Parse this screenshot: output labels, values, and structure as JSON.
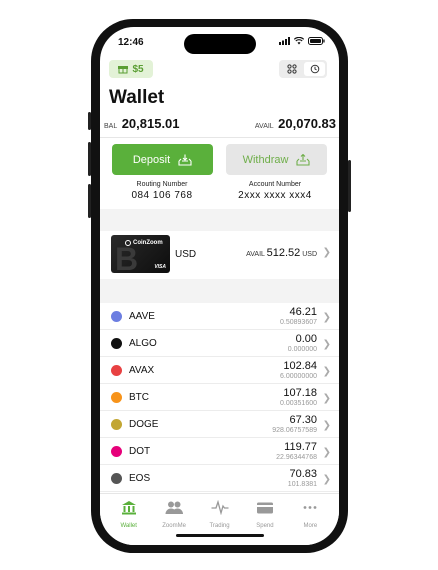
{
  "status": {
    "time": "12:46"
  },
  "gift": {
    "label": "$5"
  },
  "page": {
    "title": "Wallet"
  },
  "balance": {
    "bal_label": "BAL",
    "bal_value": "20,815.01",
    "avail_label": "AVAIL",
    "avail_value": "20,070.83"
  },
  "actions": {
    "deposit_label": "Deposit",
    "withdraw_label": "Withdraw"
  },
  "account": {
    "routing_label": "Routing Number",
    "routing_value": "084 106 768",
    "account_label": "Account Number",
    "account_value": "2xxx xxxx xxx4"
  },
  "card": {
    "brand": "CoinZoom",
    "network": "VISA",
    "currency": "USD",
    "avail_label": "AVAIL",
    "avail_value": "512.52",
    "avail_unit": "USD"
  },
  "coins": [
    {
      "symbol": "AAVE",
      "value": "46.21",
      "sub": "0.50893607",
      "icon": "aave-icon",
      "color": "#6c7ee1"
    },
    {
      "symbol": "ALGO",
      "value": "0.00",
      "sub": "0.000000",
      "icon": "algo-icon",
      "color": "#111111"
    },
    {
      "symbol": "AVAX",
      "value": "102.84",
      "sub": "6.00000000",
      "icon": "avax-icon",
      "color": "#e84142"
    },
    {
      "symbol": "BTC",
      "value": "107.18",
      "sub": "0.00351600",
      "icon": "btc-icon",
      "color": "#f7931a"
    },
    {
      "symbol": "DOGE",
      "value": "67.30",
      "sub": "928.06757589",
      "icon": "doge-icon",
      "color": "#c2a633"
    },
    {
      "symbol": "DOT",
      "value": "119.77",
      "sub": "22.96344768",
      "icon": "dot-icon",
      "color": "#e6007a"
    },
    {
      "symbol": "EOS",
      "value": "70.83",
      "sub": "101.8381",
      "icon": "eos-icon",
      "color": "#555555"
    }
  ],
  "tabs": [
    {
      "label": "Wallet",
      "icon": "bank-icon",
      "active": true
    },
    {
      "label": "ZoomMe",
      "icon": "users-icon",
      "active": false
    },
    {
      "label": "Trading",
      "icon": "pulse-icon",
      "active": false
    },
    {
      "label": "Spend",
      "icon": "card-icon",
      "active": false
    },
    {
      "label": "More",
      "icon": "more-icon",
      "active": false
    }
  ],
  "colors": {
    "accent": "#5ab03b",
    "accent_light": "#e3f2d7",
    "chevron": "#aaaaaa"
  }
}
